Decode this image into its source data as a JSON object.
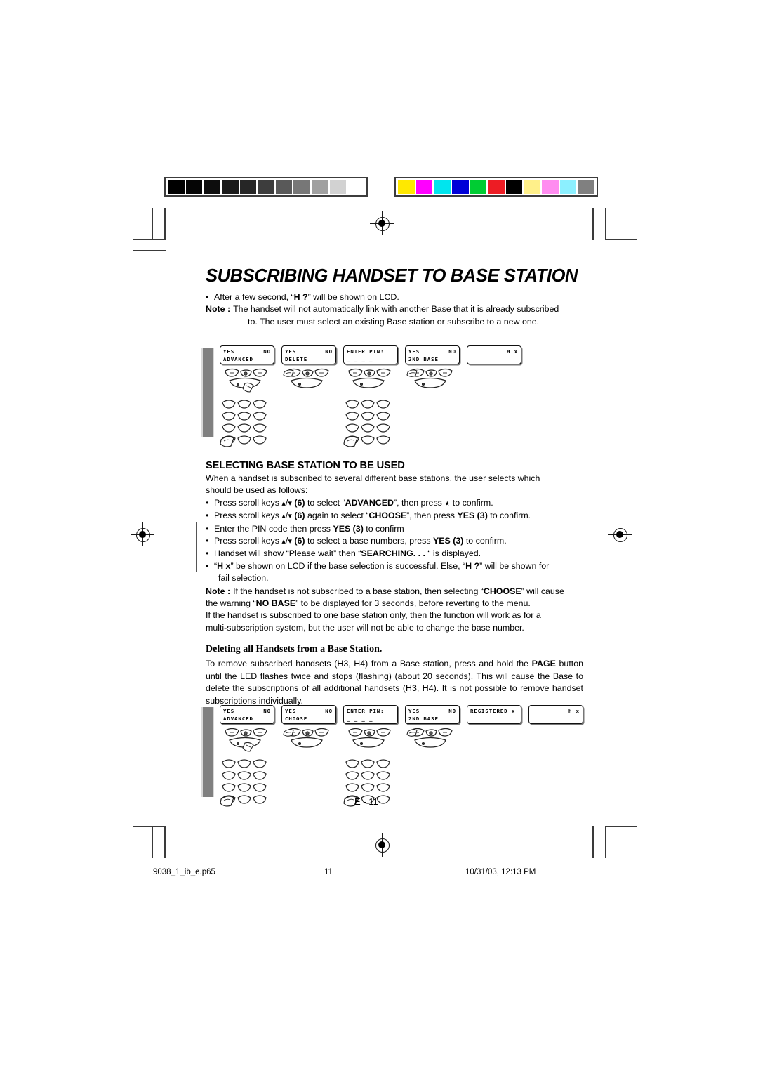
{
  "calibration": {
    "grayscale_label": "grayscale-step-wedge",
    "grayscale": [
      "#000000",
      "#050505",
      "#0d0d0d",
      "#1a1a1a",
      "#262626",
      "#3d3d3d",
      "#595959",
      "#777777",
      "#a0a0a0",
      "#d2d2d2",
      "#ffffff"
    ],
    "colorbar_label": "color-control-bar",
    "colors": [
      "#ffe800",
      "#ff00ff",
      "#00e5ee",
      "#0000d8",
      "#00cc33",
      "#ed1c24",
      "#000000",
      "#fff08a",
      "#ff8cf0",
      "#8cf0ff",
      "#808080"
    ]
  },
  "title": "SUBSCRIBING HANDSET TO BASE STATION",
  "intro": {
    "bullet": {
      "pre": "After a few second, “",
      "bold": "H ?",
      "post": "” will be shown on LCD."
    },
    "note_label": "Note :",
    "note_line1": "The handset will not automatically link with another Base that it is already subscribed",
    "note_line2": "to. The user must select an existing Base station or subscribe to a new one."
  },
  "illustration_one": {
    "steps": [
      {
        "name": "lcd-advanced",
        "line1_left": "YES",
        "line1_right": "NO",
        "line2": "ADVANCED",
        "keypad": "softkeys-hand-right"
      },
      {
        "name": "lcd-delete",
        "line1_left": "YES",
        "line1_right": "NO",
        "line2": "DELETE",
        "keypad": "softkeys-hand-left"
      },
      {
        "name": "lcd-enter-pin",
        "line1_left": "ENTER PIN:",
        "line1_right": "",
        "line2": "_ _ _ _",
        "keypad": "numpad-hand"
      },
      {
        "name": "lcd-2nd-base",
        "line1_left": "YES",
        "line1_right": "NO",
        "line2": "2ND BASE",
        "keypad": "softkeys-hand-left"
      },
      {
        "name": "lcd-handset-result",
        "line1_left": "",
        "line1_right": "H x",
        "line2": "",
        "keypad": "none"
      }
    ]
  },
  "selecting": {
    "heading": "SELECTING BASE STATION TO BE USED",
    "intro_line1": "When a handset is subscribed to several different base stations, the user selects which",
    "intro_line2": "should be used as follows:",
    "bullets": [
      {
        "segments": [
          {
            "t": "Press scroll keys ",
            "b": false
          },
          {
            "t": "ARROWS",
            "b": false,
            "icon": true
          },
          {
            "t": " (6)",
            "b": true
          },
          {
            "t": " to select “",
            "b": false
          },
          {
            "t": "ADVANCED",
            "b": true
          },
          {
            "t": "”, then press ",
            "b": false
          },
          {
            "t": "STAR",
            "b": false,
            "star": true
          },
          {
            "t": " to confirm.",
            "b": false
          }
        ]
      },
      {
        "segments": [
          {
            "t": "Press scroll keys ",
            "b": false
          },
          {
            "t": "ARROWS",
            "b": false,
            "icon": true
          },
          {
            "t": " (6)",
            "b": true
          },
          {
            "t": " again to select “",
            "b": false
          },
          {
            "t": "CHOOSE",
            "b": true
          },
          {
            "t": "”, then press ",
            "b": false
          },
          {
            "t": "YES",
            "b": true
          },
          {
            "t": " (3)",
            "b": true
          },
          {
            "t": " to confirm.",
            "b": false
          }
        ]
      },
      {
        "segments": [
          {
            "t": "Enter the PIN code then press ",
            "b": false
          },
          {
            "t": "YES",
            "b": true
          },
          {
            "t": " (3)",
            "b": true
          },
          {
            "t": " to confirm",
            "b": false
          }
        ]
      },
      {
        "segments": [
          {
            "t": "Press scroll keys ",
            "b": false
          },
          {
            "t": "ARROWS",
            "b": false,
            "icon": true
          },
          {
            "t": " (6)",
            "b": true
          },
          {
            "t": " to select a base numbers, press ",
            "b": false
          },
          {
            "t": "YES",
            "b": true
          },
          {
            "t": " (3)",
            "b": true
          },
          {
            "t": " to confirm.",
            "b": false
          }
        ]
      },
      {
        "segments": [
          {
            "t": "Handset will show “Please wait” then “",
            "b": false
          },
          {
            "t": "SEARCHING. . .",
            "b": true
          },
          {
            "t": " “ is displayed.",
            "b": false
          }
        ]
      },
      {
        "segments": [
          {
            "t": "“",
            "b": false
          },
          {
            "t": "H x",
            "b": true
          },
          {
            "t": "” be shown on LCD if the base selection is successful. Else, “",
            "b": false
          },
          {
            "t": "H ?",
            "b": true
          },
          {
            "t": "” will be shown for",
            "b": false
          }
        ],
        "cont": "fail selection."
      }
    ],
    "note_label": "Note :",
    "note_line1_a": "If the handset is not subscribed to a base station, then selecting “",
    "note_line1_b": "CHOOSE",
    "note_line1_c": "” will cause",
    "note_line2_a": "the warning “",
    "note_line2_b": "NO BASE",
    "note_line2_c": "” to be displayed for 3 seconds, before reverting to the menu.",
    "para2_line1": "If the handset is subscribed to one base station only, then the function will work as for a",
    "para2_line2": "multi-subscription system, but the user will not be able to change the base number."
  },
  "deleting": {
    "heading": "Deleting all Handsets from a Base Station.",
    "para_a": "To remove subscribed handsets (H3, H4) from a Base station, press and hold the ",
    "para_b": "PAGE",
    "para_c": " button until the LED flashes twice and stops (flashing) (about 20 seconds). This will cause the Base to delete the subscriptions of all additional handsets (H3, H4). It is not possible to remove handset subscriptions individually."
  },
  "illustration_two": {
    "steps": [
      {
        "name": "lcd-advanced",
        "line1_left": "YES",
        "line1_right": "NO",
        "line2": "ADVANCED",
        "keypad": "softkeys-hand-right"
      },
      {
        "name": "lcd-choose",
        "line1_left": "YES",
        "line1_right": "NO",
        "line2": "CHOOSE",
        "keypad": "softkeys-hand-left"
      },
      {
        "name": "lcd-enter-pin",
        "line1_left": "ENTER PIN:",
        "line1_right": "",
        "line2": "_ _ _ _",
        "keypad": "numpad-hand"
      },
      {
        "name": "lcd-2nd-base",
        "line1_left": "YES",
        "line1_right": "NO",
        "line2": "2ND BASE",
        "keypad": "softkeys-hand-left"
      },
      {
        "name": "lcd-registered",
        "line1_left": "REGISTERED x",
        "line1_right": "",
        "line2": "",
        "keypad": "none"
      },
      {
        "name": "lcd-handset-result",
        "line1_left": "",
        "line1_right": "H x",
        "line2": "",
        "keypad": "none"
      }
    ]
  },
  "page_marker": "E - 11",
  "footer": {
    "filename": "9038_1_ib_e.p65",
    "page_number": "11",
    "timestamp": "10/31/03, 12:13 PM"
  }
}
